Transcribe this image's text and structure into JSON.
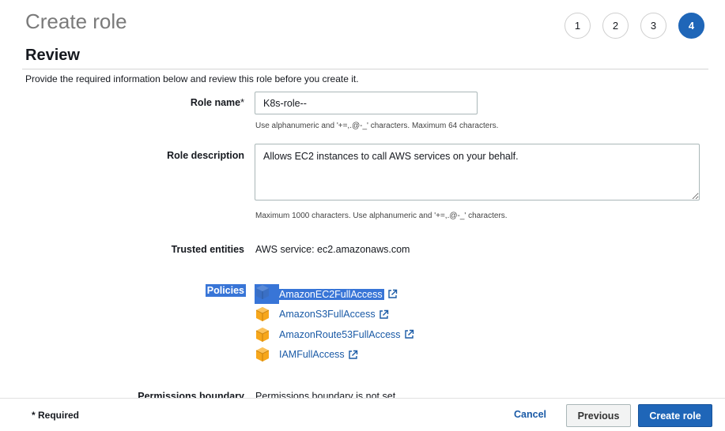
{
  "page": {
    "title": "Create role",
    "section_title": "Review",
    "intro": "Provide the required information below and review this role before you create it."
  },
  "steps": [
    {
      "label": "1",
      "active": false
    },
    {
      "label": "2",
      "active": false
    },
    {
      "label": "3",
      "active": false
    },
    {
      "label": "4",
      "active": true
    }
  ],
  "role_name": {
    "label": "Role name",
    "required_mark": "*",
    "value": "K8s-role--",
    "hint": "Use alphanumeric and '+=,.@-_' characters. Maximum 64 characters."
  },
  "role_description": {
    "label": "Role description",
    "value": "Allows EC2 instances to call AWS services on your behalf.",
    "hint": "Maximum 1000 characters. Use alphanumeric and '+=,.@-_' characters."
  },
  "trusted_entities": {
    "label": "Trusted entities",
    "value": "AWS service: ec2.amazonaws.com"
  },
  "policies": {
    "label": "Policies",
    "items": [
      {
        "name": "AmazonEC2FullAccess",
        "icon": "policy-cube-icon"
      },
      {
        "name": "AmazonS3FullAccess",
        "icon": "policy-cube-icon"
      },
      {
        "name": "AmazonRoute53FullAccess",
        "icon": "policy-cube-icon"
      },
      {
        "name": "IAMFullAccess",
        "icon": "policy-cube-icon"
      }
    ]
  },
  "permissions_boundary": {
    "label": "Permissions boundary",
    "value": "Permissions boundary is not set"
  },
  "footer": {
    "required_note": "* Required",
    "cancel_label": "Cancel",
    "previous_label": "Previous",
    "create_label": "Create role"
  },
  "colors": {
    "primary": "#1f66b8",
    "link": "#1a5aa6",
    "cube": "#f7a71b",
    "selection": "#3875d7"
  }
}
